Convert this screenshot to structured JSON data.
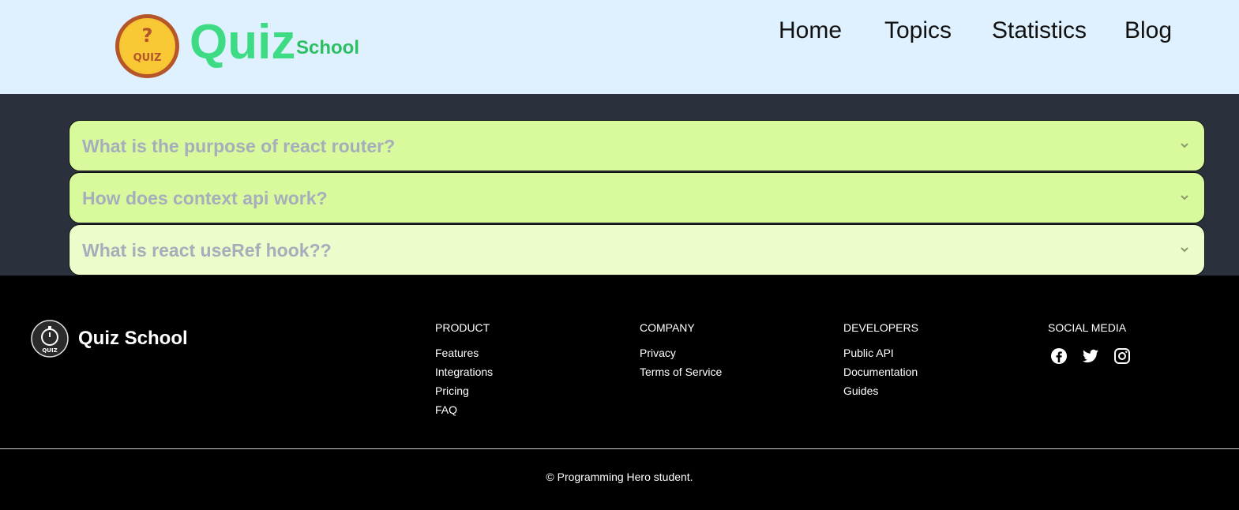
{
  "header": {
    "brand_main": "Quiz",
    "brand_sub": "School",
    "logo_text": "QUIZ",
    "nav": [
      {
        "label": "Home"
      },
      {
        "label": "Topics"
      },
      {
        "label": "Statistics"
      },
      {
        "label": "Blog"
      }
    ]
  },
  "faq": [
    {
      "question": "What is the purpose of react router?",
      "bg": "#d9f99d"
    },
    {
      "question": "How does context api work?",
      "bg": "#d9f99d"
    },
    {
      "question": "What is react useRef hook??",
      "bg": "#ecfccb"
    }
  ],
  "footer": {
    "brand": "Quiz School",
    "logo_text": "QUIZ",
    "columns": [
      {
        "heading": "PRODUCT",
        "links": [
          "Features",
          "Integrations",
          "Pricing",
          "FAQ"
        ]
      },
      {
        "heading": "COMPANY",
        "links": [
          "Privacy",
          "Terms of Service"
        ]
      },
      {
        "heading": "DEVELOPERS",
        "links": [
          "Public API",
          "Documentation",
          "Guides"
        ]
      },
      {
        "heading": "SOCIAL MEDIA",
        "icons": [
          "facebook-icon",
          "twitter-icon",
          "instagram-icon"
        ]
      }
    ],
    "copyright": "© Programming Hero student."
  },
  "colors": {
    "header_bg": "#dff1ff",
    "brand_green": "#3ddc84",
    "main_bg": "#2a303c",
    "footer_bg": "#000000"
  }
}
